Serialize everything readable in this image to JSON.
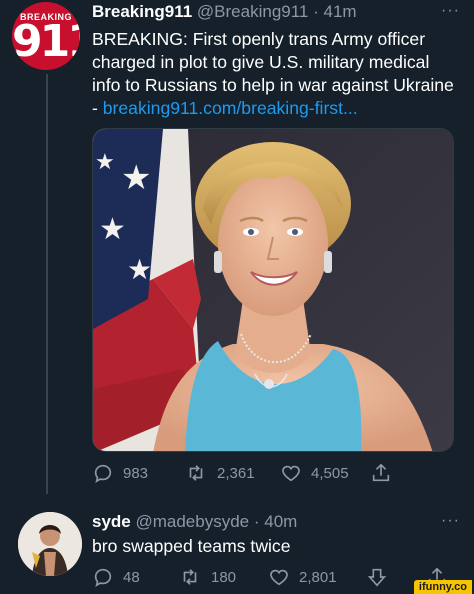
{
  "tweet": {
    "avatar_text_small": "BREAKING",
    "avatar_text_big": "911",
    "display_name": "Breaking911",
    "handle_time": "@Breaking911 · 41m",
    "more": "···",
    "text": "BREAKING: First openly trans Army officer charged in plot to give U.S. military medical info to Russians to help in war against Ukraine - ",
    "link": "breaking911.com/breaking-first...",
    "actions": {
      "replies": "983",
      "retweets": "2,361",
      "likes": "4,505"
    }
  },
  "reply": {
    "display_name": "syde",
    "handle_time": "@madebysyde · 40m",
    "more": "···",
    "text": "bro swapped teams twice",
    "actions": {
      "replies": "48",
      "retweets": "180",
      "likes": "2,801"
    }
  },
  "watermark": "ifunny.co",
  "colors": {
    "background": "#15202b",
    "link": "#1d9bf0",
    "muted": "#8b98a5",
    "avatar_red": "#c8102e",
    "dress": "#5bb7d6"
  }
}
